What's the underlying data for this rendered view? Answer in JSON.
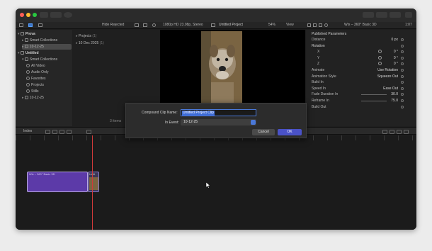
{
  "toolbar": {
    "filter_label": "Hide Rejected",
    "format_info": "1080p HD 23.98p, Stereo",
    "project_title": "Untitled Project",
    "zoom": "54%",
    "view_label": "View",
    "inspector_title": "Wix – 360° Basic 3D",
    "inspector_time": "1:07"
  },
  "library": {
    "rows": [
      {
        "label": "Prova",
        "depth": 0,
        "expanded": true,
        "bold": true
      },
      {
        "label": "Smart Collections",
        "depth": 1,
        "expanded": false,
        "bold": false
      },
      {
        "label": "10-12-25",
        "depth": 1,
        "expanded": false,
        "bold": false,
        "selected": true
      },
      {
        "label": "Untitled",
        "depth": 0,
        "expanded": true,
        "bold": true
      },
      {
        "label": "Smart Collections",
        "depth": 1,
        "expanded": true,
        "bold": false
      },
      {
        "label": "All Video",
        "depth": 2,
        "bold": false
      },
      {
        "label": "Audio Only",
        "depth": 2,
        "bold": false
      },
      {
        "label": "Favorites",
        "depth": 2,
        "bold": false
      },
      {
        "label": "Projects",
        "depth": 2,
        "bold": false
      },
      {
        "label": "Stills",
        "depth": 2,
        "bold": false
      },
      {
        "label": "10-12-25",
        "depth": 1,
        "expanded": false,
        "bold": false
      }
    ]
  },
  "browser": {
    "groups": [
      {
        "label": "Projects",
        "count": "(1)"
      },
      {
        "label": "10 Dec 2025",
        "count": "(1)"
      }
    ],
    "items_count": "3 items"
  },
  "inspector": {
    "section_title": "Published Parameters",
    "rows": [
      {
        "label": "Distance",
        "value": "0 px",
        "indent": false
      },
      {
        "label": "Rotation",
        "value": "",
        "indent": false,
        "header": true
      },
      {
        "label": "X",
        "value": "0 °",
        "indent": true,
        "knob": true
      },
      {
        "label": "Y",
        "value": "0 °",
        "indent": true,
        "knob": true
      },
      {
        "label": "Z",
        "value": "0 °",
        "indent": true,
        "knob": true
      },
      {
        "label": "Animate",
        "value": "Use Rotation",
        "indent": false
      },
      {
        "label": "Animation Style",
        "value": "Squeeze Out",
        "indent": false
      },
      {
        "label": "Build In",
        "value": "",
        "indent": false
      },
      {
        "label": "Speed In",
        "value": "Ease Out",
        "indent": false
      },
      {
        "label": "Fade Duration In",
        "value": "30.0",
        "indent": false,
        "slider": true
      },
      {
        "label": "Reframe In",
        "value": "75.0",
        "indent": false,
        "slider": true
      },
      {
        "label": "Build Out",
        "value": "",
        "indent": false
      }
    ]
  },
  "timeline": {
    "index_label": "Index",
    "clip_label": "Wix – 360° Basic 3D",
    "second_clip_label": "Untit",
    "accent": "#5c3aa8"
  },
  "dialog": {
    "name_label": "Compound Clip Name:",
    "name_value": "Untitled Project Clip",
    "event_label": "In Event:",
    "event_value": "10-12-25",
    "cancel_label": "Cancel",
    "ok_label": "OK"
  }
}
